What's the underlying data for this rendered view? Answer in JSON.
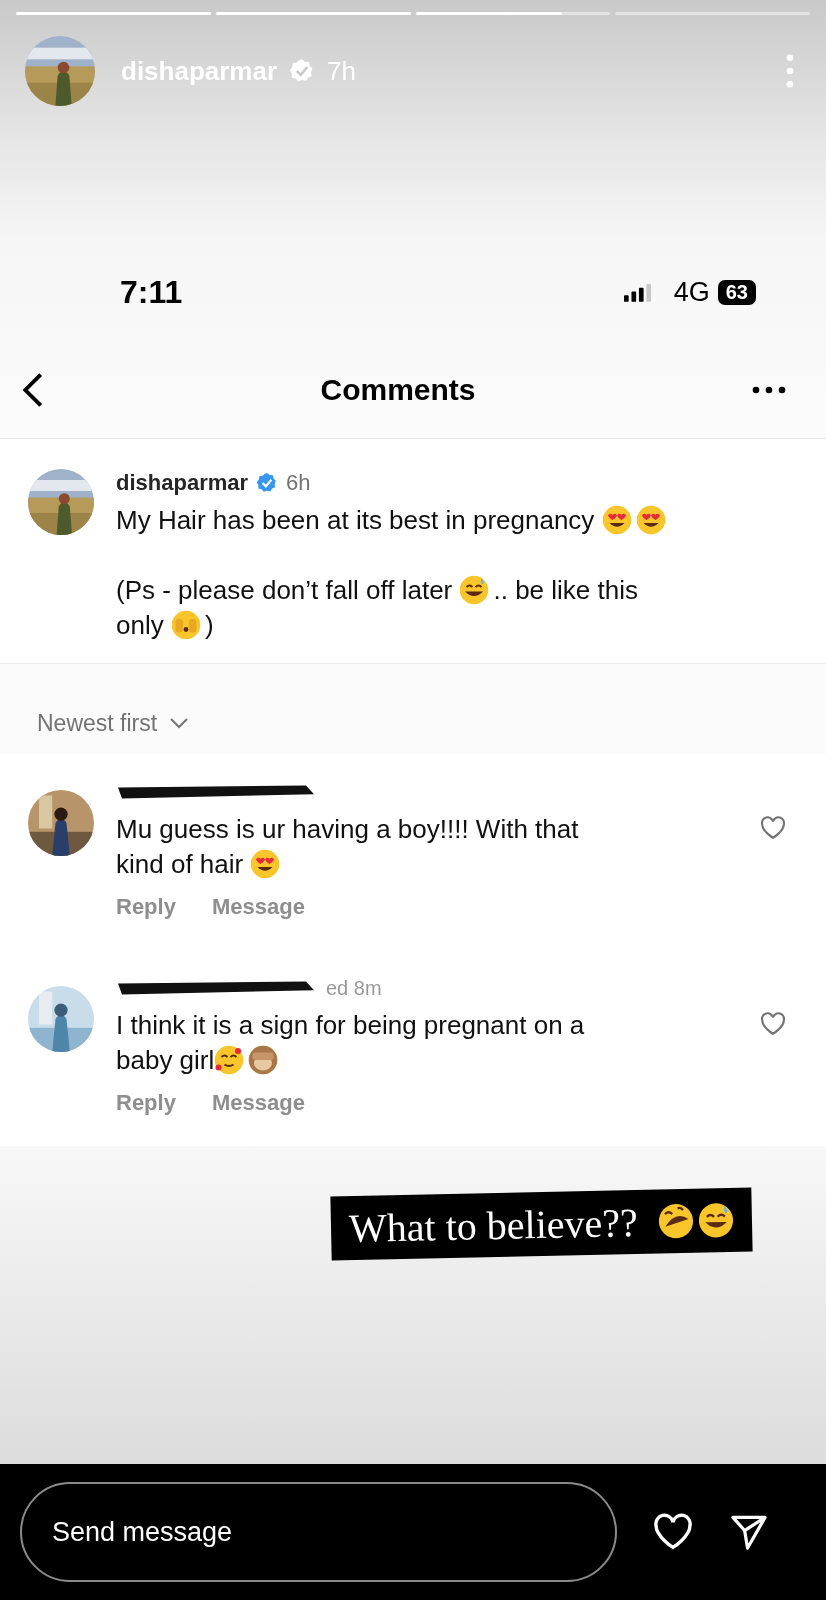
{
  "story": {
    "progress": [
      {
        "kind": "segment",
        "level": 1
      },
      {
        "kind": "segment",
        "level": 1
      },
      {
        "kind": "segment",
        "level": 0.75
      },
      {
        "kind": "segment"
      }
    ],
    "username": "dishaparmar",
    "verified": true,
    "time": "7h"
  },
  "phone_status": {
    "time": "7:11",
    "network": "4G",
    "battery": "63"
  },
  "header": {
    "title": "Comments"
  },
  "caption": {
    "username": "dishaparmar",
    "verified": true,
    "time": "6h",
    "paragraphs": [
      [
        [
          {
            "text": "My Hair has been at its best in pregnancy "
          },
          {
            "kind": "heart-eyes"
          },
          {
            "kind": "heart-eyes"
          }
        ]
      ],
      [
        [
          {
            "text": "(Ps - please don’t fall off later "
          },
          {
            "kind": "sweat-smile"
          },
          {
            "text": ".. be like this"
          }
        ],
        [
          {
            "text": "only "
          },
          {
            "kind": "peeking"
          },
          {
            "text": ")"
          }
        ]
      ]
    ]
  },
  "sort": {
    "label": "Newest first"
  },
  "comments": [
    {
      "lines": [
        [
          {
            "text": "Mu guess is ur having a boy!!!! With that"
          }
        ],
        [
          {
            "text": "kind of hair "
          },
          {
            "kind": "heart-eyes"
          }
        ]
      ],
      "actions": [
        "Reply",
        "Message"
      ],
      "liked": false
    },
    {
      "visible_fragment": "ed 8m",
      "lines": [
        [
          {
            "text": "I think it is a sign for being pregnant on a"
          }
        ],
        [
          {
            "text": "baby girl"
          },
          {
            "kind": "smiling-hearts"
          },
          {
            "kind": "see-no-evil"
          }
        ]
      ],
      "actions": [
        "Reply",
        "Message"
      ],
      "liked": false
    }
  ],
  "sticker": {
    "text": "What to believe??",
    "emojis": [
      {
        "kind": "rofl"
      },
      {
        "kind": "sweat-smile"
      }
    ]
  },
  "reply_bar": {
    "placeholder": "Send message"
  }
}
